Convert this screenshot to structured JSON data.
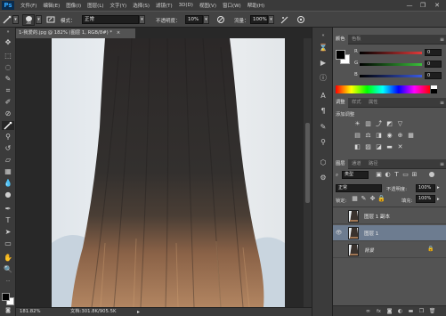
{
  "app": {
    "logo": "Ps"
  },
  "menu": [
    "文件(F)",
    "编辑(E)",
    "图像(I)",
    "图层(L)",
    "文字(Y)",
    "选择(S)",
    "滤镜(T)",
    "3D(D)",
    "视图(V)",
    "窗口(W)",
    "帮助(H)"
  ],
  "window_controls": {
    "minimize": "—",
    "restore": "❐",
    "close": "✕"
  },
  "options_bar": {
    "brush_size": "38",
    "mode_label": "模式：",
    "mode_value": "正常",
    "opacity_label": "不透明度：",
    "opacity_value": "10%",
    "flow_label": "流量：",
    "flow_value": "100%"
  },
  "document_tab": {
    "title": "1-我爱的.jpg @ 182% (图层 1, RGB/8#) *",
    "close": "×"
  },
  "status_bar": {
    "zoom": "181.82%",
    "doc_info": "文档:301.8K/905.5K"
  },
  "color_panel": {
    "tabs": [
      "颜色",
      "色板"
    ],
    "channels": [
      {
        "label": "R",
        "value": "0",
        "color": "#e03a3a"
      },
      {
        "label": "G",
        "value": "0",
        "color": "#3ac03a"
      },
      {
        "label": "B",
        "value": "0",
        "color": "#3a5ae0"
      }
    ],
    "foreground_color": "#000000",
    "background_color": "#ffffff"
  },
  "adjustments_panel": {
    "tabs": [
      "调整",
      "样式",
      "属性"
    ],
    "heading": "添加调整"
  },
  "layers_panel": {
    "tabs": [
      "图层",
      "通道",
      "路径"
    ],
    "kind_filter": "类型",
    "blend_mode": "正常",
    "opacity_label": "不透明度:",
    "opacity_value": "100%",
    "lock_label": "锁定:",
    "fill_label": "填充:",
    "fill_value": "100%",
    "layers": [
      {
        "name": "图层 1 副本",
        "visible": false,
        "selected": false,
        "locked": false
      },
      {
        "name": "图层 1",
        "visible": true,
        "selected": true,
        "locked": false
      },
      {
        "name": "背景",
        "visible": false,
        "selected": false,
        "locked": true
      }
    ],
    "bottom_icons": [
      "link-icon",
      "fx-icon",
      "mask-icon",
      "adjustment-icon",
      "folder-icon",
      "new-layer-icon",
      "trash-icon"
    ]
  }
}
